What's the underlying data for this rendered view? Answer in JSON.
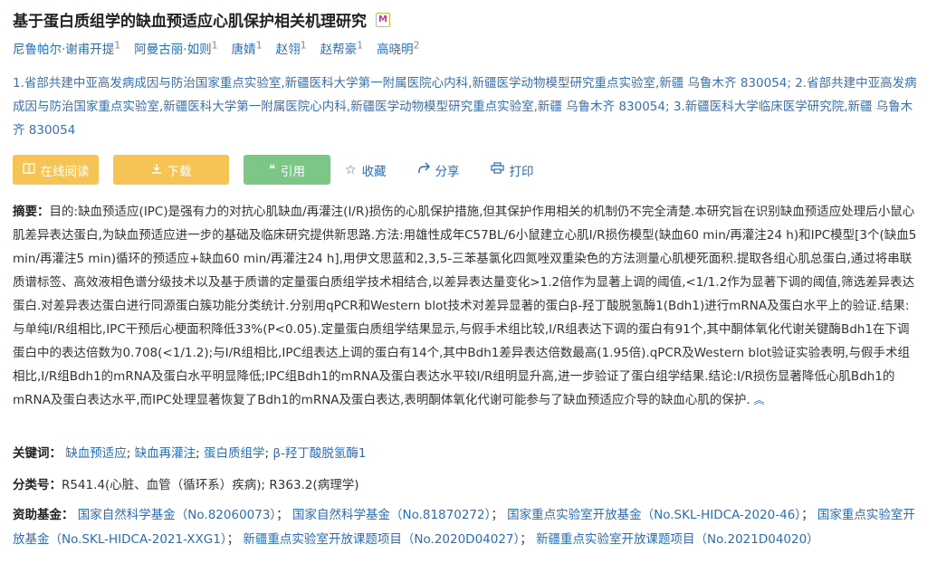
{
  "title": "基于蛋白质组学的缺血预适应心肌保护相关机理研究",
  "badge_letter": "M",
  "authors": [
    {
      "name": "尼鲁帕尔·谢甫开提",
      "sup": "1"
    },
    {
      "name": "阿曼古丽·如则",
      "sup": "1"
    },
    {
      "name": "唐婧",
      "sup": "1"
    },
    {
      "name": "赵翎",
      "sup": "1"
    },
    {
      "name": "赵帮豪",
      "sup": "1"
    },
    {
      "name": "高晓明",
      "sup": "2"
    }
  ],
  "affiliations": "1.省部共建中亚高发病成因与防治国家重点实验室,新疆医科大学第一附属医院心内科,新疆医学动物模型研究重点实验室,新疆 乌鲁木齐 830054; 2.省部共建中亚高发病成因与防治国家重点实验室,新疆医科大学第一附属医院心内科,新疆医学动物模型研究重点实验室,新疆 乌鲁木齐 830054; 3.新疆医科大学临床医学研究院,新疆 乌鲁木齐 830054",
  "actions": {
    "read": "在线阅读",
    "download": "下载",
    "cite": "引用",
    "favorite": "收藏",
    "share": "分享",
    "print": "打印"
  },
  "abstract": {
    "label": "摘要：",
    "text": "目的:缺血预适应(IPC)是强有力的对抗心肌缺血/再灌注(I/R)损伤的心肌保护措施,但其保护作用相关的机制仍不完全清楚.本研究旨在识别缺血预适应处理后小鼠心肌差异表达蛋白,为缺血预适应进一步的基础及临床研究提供新思路.方法:用雄性成年C57BL/6小鼠建立心肌I/R损伤模型(缺血60 min/再灌注24 h)和IPC模型[3个(缺血5 min/再灌注5 min)循环的预适应+缺血60 min/再灌注24 h],用伊文思蓝和2,3,5-三苯基氯化四氮唑双重染色的方法测量心肌梗死面积.提取各组心肌总蛋白,通过将串联质谱标签、高效液相色谱分级技术以及基于质谱的定量蛋白质组学技术相结合,以差异表达量变化>1.2倍作为显著上调的阈值,<1/1.2作为显著下调的阈值,筛选差异表达蛋白.对差异表达蛋白进行同源蛋白簇功能分类统计.分别用qPCR和Western blot技术对差异显著的蛋白β-羟丁酸脱氢酶1(Bdh1)进行mRNA及蛋白水平上的验证.结果:与单纯I/R组相比,IPC干预后心梗面积降低33%(P<0.05).定量蛋白质组学结果显示,与假手术组比较,I/R组表达下调的蛋白有91个,其中酮体氧化代谢关键酶Bdh1在下调蛋白中的表达倍数为0.708(<1/1.2);与I/R组相比,IPC组表达上调的蛋白有14个,其中Bdh1差异表达倍数最高(1.95倍).qPCR及Western blot验证实验表明,与假手术组相比,I/R组Bdh1的mRNA及蛋白水平明显降低;IPC组Bdh1的mRNA及蛋白表达水平较I/R组明显升高,进一步验证了蛋白组学结果.结论:I/R损伤显著降低心肌Bdh1的mRNA及蛋白表达水平,而IPC处理显著恢复了Bdh1的mRNA及蛋白表达,表明酮体氧化代谢可能参与了缺血预适应介导的缺血心肌的保护."
  },
  "keywords": {
    "label": "关键词：",
    "items": [
      "缺血预适应",
      "缺血再灌注",
      "蛋白质组学",
      "β-羟丁酸脱氢酶1"
    ]
  },
  "classification": {
    "label": "分类号：",
    "value": "R541.4(心脏、血管（循环系）疾病); R363.2(病理学)"
  },
  "funding": {
    "label": "资助基金：",
    "items": [
      "国家自然科学基金（No.82060073）",
      "国家自然科学基金（No.81870272）",
      "国家重点实验室开放基金（No.SKL-HIDCA-2020-46）",
      "国家重点实验室开放基金（No.SKL-HIDCA-2021-XXG1）",
      "新疆重点实验室开放课题项目（No.2020D04027）",
      "新疆重点实验室开放课题项目（No.2021D04020）"
    ]
  },
  "colors": {
    "link": "#2a6db8",
    "button_yellow": "#f6c455",
    "button_green": "#7cc788"
  }
}
